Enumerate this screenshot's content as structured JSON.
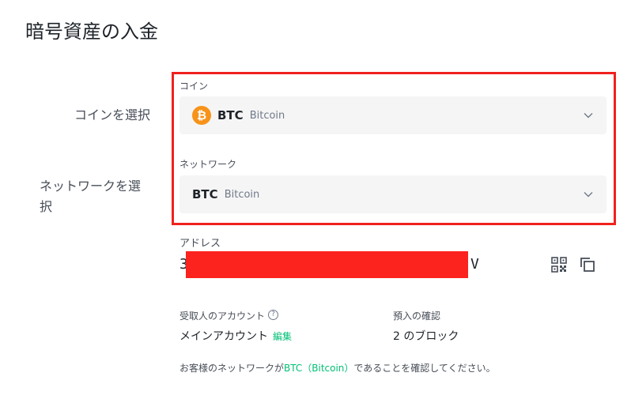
{
  "page": {
    "title": "暗号資産の入金"
  },
  "side": {
    "coin": "コインを選択",
    "network": "ネットワークを選択"
  },
  "coin_field": {
    "label": "コイン",
    "icon": "bitcoin-icon",
    "symbol": "BTC",
    "name": "Bitcoin"
  },
  "network_field": {
    "label": "ネットワーク",
    "symbol": "BTC",
    "name": "Bitcoin"
  },
  "address": {
    "label": "アドレス",
    "first_char": "3",
    "last_char": "V"
  },
  "account": {
    "label": "受取人のアカウント",
    "value": "メインアカウント",
    "edit": "編集"
  },
  "confirm": {
    "label": "預入の確認",
    "value": "2 のブロック"
  },
  "note": {
    "prefix": "お客様のネットワークが",
    "network": "BTC（Bitcoin）",
    "suffix": "であることを確認してください。"
  },
  "colors": {
    "accent": "#02c076",
    "highlight": "#f0211e",
    "redaction": "#fc221e",
    "bitcoin": "#f7931a"
  }
}
